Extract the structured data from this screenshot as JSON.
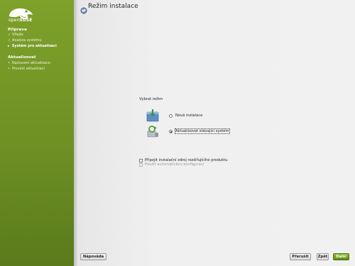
{
  "sidebar": {
    "logo": {
      "prefix": "open",
      "brand": "SUSE"
    },
    "sections": [
      {
        "title": "Příprava",
        "steps": [
          {
            "label": "Vítejte",
            "state": "done"
          },
          {
            "label": "Analýza systému",
            "state": "done"
          },
          {
            "label": "Systém pro aktualizaci",
            "state": "current"
          }
        ]
      },
      {
        "title": "Aktualizovat",
        "steps": [
          {
            "label": "Nastavení aktualizace",
            "state": "pending"
          },
          {
            "label": "Provést aktualizaci",
            "state": "pending"
          }
        ]
      }
    ],
    "marks": {
      "done": "✓",
      "current": "▸",
      "pending": "•"
    }
  },
  "main": {
    "title": "Režim instalace",
    "mode_group_label": "Vybrat režim",
    "options": [
      {
        "label": "Nová instalace",
        "selected": false
      },
      {
        "label": "Aktualizovat stávající systém",
        "selected": true
      }
    ],
    "checkboxes": [
      {
        "label": "Připojit instalační zdroj rozšiřujícího produktu",
        "checked": false,
        "enabled": true
      },
      {
        "label": "Použít automatickou konfiguraci",
        "checked": false,
        "enabled": false
      }
    ]
  },
  "buttons": {
    "help": "Nápověda",
    "abort": "Přerušit",
    "back": "Zpět",
    "next": "Další"
  },
  "colors": {
    "sidebar_green": "#6e9024",
    "next_button": "#6fa01f"
  }
}
